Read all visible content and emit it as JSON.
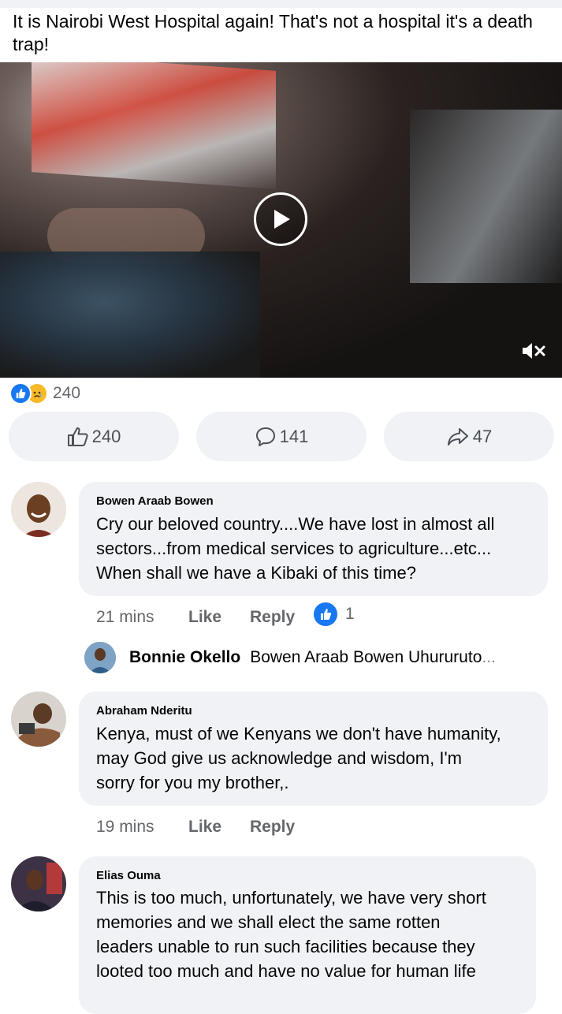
{
  "post": {
    "text": "It is Nairobi West Hospital again! That's not a hospital it's a death trap!"
  },
  "video": {
    "play_icon": "play-icon",
    "mute_icon": "muted-speaker-icon"
  },
  "reactions": {
    "count": "240",
    "icons": [
      "like-reaction-icon",
      "sad-reaction-icon"
    ]
  },
  "actions": {
    "like_count": "240",
    "comment_count": "141",
    "share_count": "47"
  },
  "comments": [
    {
      "author": "Bowen Araab Bowen",
      "text_lines": [
        "Cry our beloved country....We have lost in almost all",
        "sectors...from medical services to agriculture...etc...",
        "When shall we have a Kibaki of this time?"
      ],
      "time": "21 mins",
      "like_label": "Like",
      "reply_label": "Reply",
      "likes": "1",
      "reply_preview": {
        "author": "Bonnie Okello",
        "text": "Bowen Araab Bowen Uhururuto",
        "ellipsis": "..."
      }
    },
    {
      "author": "Abraham Nderitu",
      "text_lines": [
        "Kenya, must of we Kenyans we don't have humanity,",
        "may God give us acknowledge and wisdom, I'm",
        "sorry for you my brother,."
      ],
      "time": "19 mins",
      "like_label": "Like",
      "reply_label": "Reply"
    },
    {
      "author": "Elias Ouma",
      "text_lines": [
        "This is too much, unfortunately, we have very short",
        "memories and we shall elect the same rotten",
        "leaders unable to run such facilities because they",
        "looted too much and have no value for human life"
      ]
    }
  ],
  "colors": {
    "accent": "#1877f2",
    "bubble": "#f0f2f5",
    "meta_text": "#65676b"
  }
}
